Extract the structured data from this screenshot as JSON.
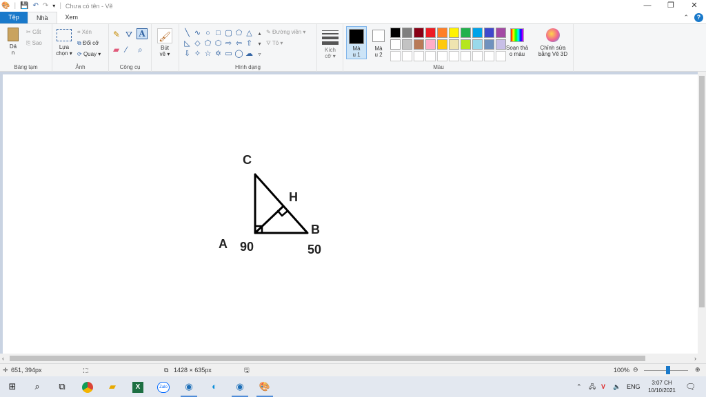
{
  "window": {
    "title": "Chưa có tên - Vẽ",
    "minimize": "—",
    "maximize": "❐",
    "close": "✕"
  },
  "tabs": {
    "file": "Tệp",
    "home": "Nhà",
    "view": "Xem"
  },
  "ribbon": {
    "clipboard": {
      "paste": "Dá",
      "paste2": "n",
      "cut": "Cắt",
      "copy": "Sao",
      "label": "Bảng tạm"
    },
    "image": {
      "select": "Lựa",
      "select2": "chọn",
      "crop": "Xén",
      "resize": "Đổi cỡ",
      "rotate": "Quay",
      "label": "Ảnh"
    },
    "tools": {
      "label": "Công cụ"
    },
    "brushes": {
      "label": "Bút",
      "label2": "vẽ"
    },
    "shapes": {
      "outline": "Đường viền",
      "fill": "Tô",
      "label": "Hình dạng"
    },
    "size": {
      "label": "Kích",
      "label2": "cỡ"
    },
    "color1": {
      "label": "Mà",
      "label2": "u 1"
    },
    "color2": {
      "label": "Mà",
      "label2": "u 2"
    },
    "colors": {
      "label": "Màu",
      "palette": [
        "#000000",
        "#7f7f7f",
        "#880015",
        "#ed1c24",
        "#ff7f27",
        "#fff200",
        "#22b14c",
        "#00a2e8",
        "#3f48cc",
        "#a349a4",
        "#ffffff",
        "#c3c3c3",
        "#b97a57",
        "#ffaec9",
        "#ffc90e",
        "#efe4b0",
        "#b5e61d",
        "#99d9ea",
        "#7092be",
        "#c8bfe7",
        "#ffffff",
        "#ffffff",
        "#ffffff",
        "#ffffff",
        "#ffffff",
        "#ffffff",
        "#ffffff",
        "#ffffff",
        "#ffffff",
        "#ffffff"
      ]
    },
    "edit_colors": {
      "label": "Soạn thả",
      "label2": "o màu"
    },
    "paint3d": {
      "label": "Chỉnh sửa",
      "label2": "bằng Vẽ 3D"
    }
  },
  "drawing": {
    "label_c": "C",
    "label_h": "H",
    "label_b": "B",
    "label_a": "A",
    "label_90": "90",
    "label_50": "50"
  },
  "status": {
    "cursor_pos": "651, 394px",
    "image_size": "1428 × 635px",
    "zoom": "100%"
  },
  "taskbar": {
    "lang": "ENG",
    "time": "3:07 CH",
    "date": "10/10/2021"
  }
}
